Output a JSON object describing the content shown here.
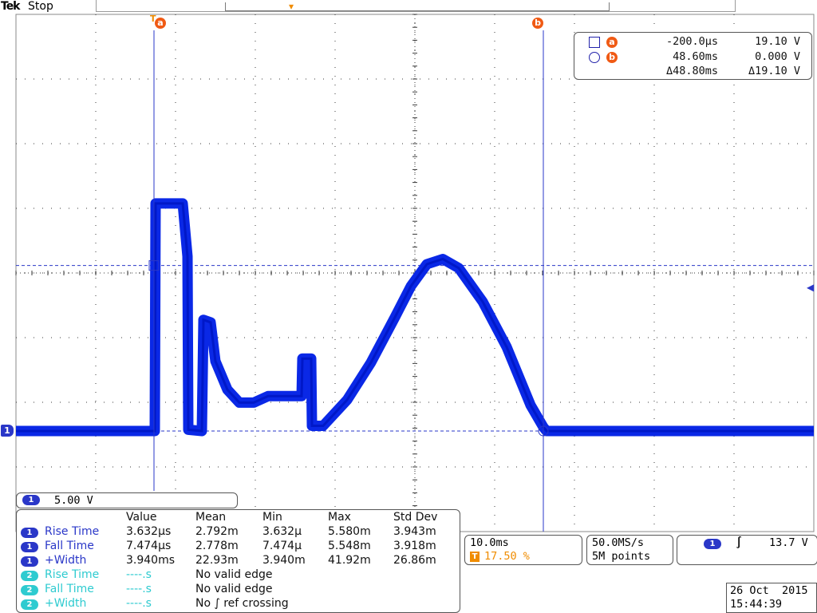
{
  "header": {
    "brand": "Tek",
    "run_state": "Stop"
  },
  "colors": {
    "channel1": "#0a28e6",
    "channel2": "#2ecbd0",
    "cursor": "#f05a14",
    "trigger": "#f08c00",
    "grid": "#3a3a3a"
  },
  "cursor_readout": {
    "a": {
      "badge": "a",
      "time": "-200.0µs",
      "value": "19.10 V"
    },
    "b": {
      "badge": "b",
      "time": "48.60ms",
      "value": "0.000 V"
    },
    "delta": {
      "time": "Δ48.80ms",
      "value": "Δ19.10 V"
    }
  },
  "cursors_labels": {
    "a": "a",
    "b": "b"
  },
  "channel_marker": "1",
  "vertical_scale": {
    "channel": "1",
    "value": "5.00 V"
  },
  "measurements": {
    "headers": [
      "Value",
      "Mean",
      "Min",
      "Max",
      "Std Dev"
    ],
    "rows": [
      {
        "ch": "1",
        "label": "Rise Time",
        "value": "3.632µs",
        "mean": "2.792m",
        "min": "3.632µ",
        "max": "5.580m",
        "std": "3.943m"
      },
      {
        "ch": "1",
        "label": "Fall Time",
        "value": "7.474µs",
        "mean": "2.778m",
        "min": "7.474µ",
        "max": "5.548m",
        "std": "3.918m"
      },
      {
        "ch": "1",
        "label": "+Width",
        "value": "3.940ms",
        "mean": "22.93m",
        "min": "3.940m",
        "max": "41.92m",
        "std": "26.86m"
      },
      {
        "ch": "2",
        "label": "Rise Time",
        "value": "----.s",
        "mean": "No valid edge"
      },
      {
        "ch": "2",
        "label": "Fall Time",
        "value": "----.s",
        "mean": "No valid edge"
      },
      {
        "ch": "2",
        "label": "+Width",
        "value": "----.s",
        "mean": "No ∫ ref crossing"
      }
    ]
  },
  "horizontal": {
    "scale": "10.0ms",
    "trigger_icon": "T",
    "trigger_position": "17.50 %"
  },
  "acquisition": {
    "rate": "50.0MS/s",
    "points": "5M points"
  },
  "trigger": {
    "channel": "1",
    "slope_symbol": "∫",
    "level": "13.7 V"
  },
  "datetime": {
    "date": "26 Oct  2015",
    "time": "15:44:39"
  },
  "waveform_ch1": {
    "units_y": "V",
    "units_x": "ms",
    "points": [
      [
        -17.5,
        0
      ],
      [
        -0.1,
        0
      ],
      [
        0,
        17.6
      ],
      [
        3.4,
        17.6
      ],
      [
        4.0,
        13.5
      ],
      [
        4.1,
        0.1
      ],
      [
        5.8,
        0
      ],
      [
        6.0,
        8.6
      ],
      [
        6.9,
        8.4
      ],
      [
        7.5,
        5.4
      ],
      [
        9.0,
        3.2
      ],
      [
        10.5,
        2.2
      ],
      [
        12.3,
        2.2
      ],
      [
        14.1,
        2.7
      ],
      [
        18.3,
        2.7
      ],
      [
        18.4,
        5.6
      ],
      [
        19.5,
        5.6
      ],
      [
        19.6,
        0.4
      ],
      [
        21.0,
        0.4
      ],
      [
        24.0,
        2.4
      ],
      [
        27.0,
        5.3
      ],
      [
        30.0,
        8.8
      ],
      [
        32.0,
        11.2
      ],
      [
        34.0,
        12.9
      ],
      [
        36.0,
        13.3
      ],
      [
        38.0,
        12.6
      ],
      [
        41.0,
        10.0
      ],
      [
        44.0,
        6.5
      ],
      [
        47.0,
        2.0
      ],
      [
        48.6,
        0.3
      ],
      [
        49.0,
        0
      ],
      [
        82.5,
        0
      ]
    ],
    "ground_level": 0,
    "ref_level": 12.8
  }
}
